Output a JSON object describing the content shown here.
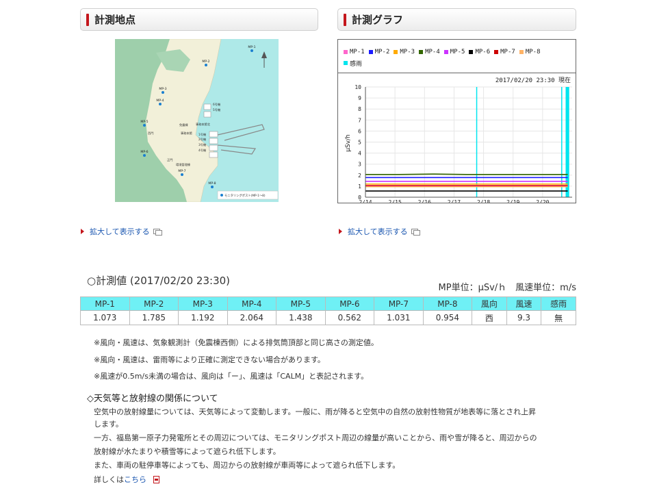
{
  "panels": {
    "map_title": "計測地点",
    "graph_title": "計測グラフ"
  },
  "map": {
    "points": [
      "MP-1",
      "MP-2",
      "MP-3",
      "MP-4",
      "MP-5",
      "MP-6",
      "MP-7",
      "MP-8"
    ],
    "labels": [
      "6号機",
      "5号機",
      "免震棟",
      "事務本館北",
      "事務本館",
      "1号機",
      "2号機",
      "3号機",
      "4号機",
      "西門",
      "正門",
      "環境管理棟"
    ],
    "legend_text": "モニタリングポスト(MP-1～8)",
    "colors": {
      "land": "#f2f0d9",
      "sea": "#aee9e8",
      "greenery": "#9ecfab",
      "point": "#1a7fd0"
    }
  },
  "graph": {
    "legend": [
      "MP-1",
      "MP-2",
      "MP-3",
      "MP-4",
      "MP-5",
      "MP-6",
      "MP-7",
      "MP-8"
    ],
    "legend_colors": [
      "#ff66cc",
      "#1a1aff",
      "#ffaa00",
      "#336600",
      "#cc33ff",
      "#000000",
      "#cc0000",
      "#ffb366"
    ],
    "rain_label": "感雨",
    "rain_color": "#00e5ee",
    "timestamp": "2017/02/20 23:30 現在"
  },
  "chart_data": {
    "type": "line",
    "ylabel": "μSv/h",
    "ylim": [
      0,
      10
    ],
    "yticks": [
      "0",
      "1",
      "2",
      "3",
      "4",
      "5",
      "6",
      "7",
      "8",
      "9",
      "10"
    ],
    "xticks": [
      "2/14",
      "2/15",
      "2/16",
      "2/17",
      "2/18",
      "2/19",
      "2/20"
    ],
    "grid": true,
    "series": [
      {
        "name": "MP-1",
        "values": [
          1.07,
          1.07,
          1.07,
          1.07,
          1.07,
          1.07,
          1.07
        ]
      },
      {
        "name": "MP-2",
        "values": [
          1.78,
          1.78,
          1.78,
          1.78,
          1.78,
          1.78,
          1.78
        ]
      },
      {
        "name": "MP-3",
        "values": [
          1.19,
          1.19,
          1.19,
          1.19,
          1.19,
          1.19,
          1.19
        ]
      },
      {
        "name": "MP-4",
        "values": [
          2.06,
          2.06,
          2.1,
          2.06,
          2.06,
          2.06,
          2.06
        ]
      },
      {
        "name": "MP-5",
        "values": [
          1.44,
          1.44,
          1.44,
          1.44,
          1.44,
          1.44,
          1.44
        ]
      },
      {
        "name": "MP-6",
        "values": [
          0.56,
          0.56,
          0.56,
          0.56,
          0.56,
          0.56,
          0.56
        ]
      },
      {
        "name": "MP-7",
        "values": [
          1.03,
          1.03,
          1.03,
          1.03,
          1.03,
          1.03,
          1.03
        ]
      },
      {
        "name": "MP-8",
        "values": [
          0.95,
          0.95,
          0.95,
          0.95,
          0.95,
          0.95,
          0.95
        ]
      }
    ],
    "rain_intervals": [
      [
        17.75,
        17.77
      ],
      [
        20.63,
        20.66
      ],
      [
        20.78,
        20.9
      ]
    ]
  },
  "enlarge_label": "拡大して表示する",
  "measure": {
    "title": "○計測値 (2017/02/20 23:30)",
    "units": "MP単位：μSv/ｈ　風速単位：m/s",
    "headers": [
      "MP-1",
      "MP-2",
      "MP-3",
      "MP-4",
      "MP-5",
      "MP-6",
      "MP-7",
      "MP-8",
      "風向",
      "風速",
      "感雨"
    ],
    "values": [
      "1.073",
      "1.785",
      "1.192",
      "2.064",
      "1.438",
      "0.562",
      "1.031",
      "0.954",
      "西",
      "9.3",
      "無"
    ]
  },
  "notes": [
    "※風向・風速は、気象観測計（免震棟西側）による排気筒頂部と同じ高さの測定値。",
    "※風向・風速は、雷雨等により正確に測定できない場合があります。",
    "※風速が0.5m/s未満の場合は、風向は「ー」、風速は「CALM」と表記されます。"
  ],
  "weather": {
    "title": "◇天気等と放射線の関係について",
    "lines": [
      "空気中の放射線量については、天気等によって変動します。一般に、雨が降ると空気中の自然の放射性物質が地表等に落とされ上昇",
      "します。",
      "一方、福島第一原子力発電所とその周辺については、モニタリングポスト周辺の線量が高いことから、雨や雪が降ると、周辺からの",
      "放射線が水たまりや積雪等によって遮られ低下します。",
      "また、車両の駐停車等によっても、周辺からの放射線が車両等によって遮られ低下します。"
    ],
    "more_prefix": "詳しくは",
    "more_link": "こちら"
  }
}
